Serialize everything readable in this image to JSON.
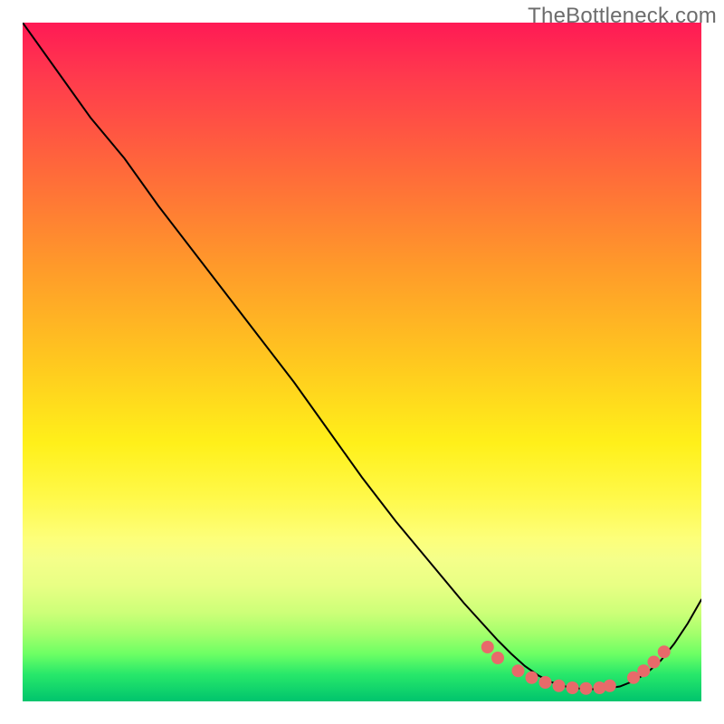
{
  "watermark": {
    "text": "TheBottleneck.com"
  },
  "chart_data": {
    "type": "line",
    "title": "",
    "xlabel": "",
    "ylabel": "",
    "x": [
      0,
      5,
      10,
      15,
      20,
      25,
      30,
      35,
      40,
      45,
      50,
      55,
      60,
      65,
      70,
      72,
      74,
      76,
      78,
      80,
      82,
      84,
      86,
      88,
      90,
      92,
      94,
      96,
      98,
      100
    ],
    "values": [
      100,
      93,
      86,
      80,
      73,
      66.5,
      60,
      53.5,
      47,
      40,
      33,
      26.5,
      20.5,
      14.5,
      9,
      7,
      5.2,
      3.8,
      2.8,
      2.2,
      1.9,
      1.8,
      1.9,
      2.2,
      3.0,
      4.2,
      6.0,
      8.5,
      11.5,
      15
    ],
    "xlim": [
      0,
      100
    ],
    "ylim": [
      0,
      100
    ],
    "grid": false,
    "legend": false,
    "background_gradient": {
      "type": "vertical",
      "stops": [
        {
          "pos": 0.0,
          "color": "#ff1a55"
        },
        {
          "pos": 0.5,
          "color": "#ffc81f"
        },
        {
          "pos": 0.8,
          "color": "#f5ff8a"
        },
        {
          "pos": 1.0,
          "color": "#00c46d"
        }
      ]
    },
    "marker_series": {
      "name": "optimal-band",
      "color": "#e86a6a",
      "points": [
        {
          "x": 68.5,
          "y": 8.0
        },
        {
          "x": 70.0,
          "y": 6.4
        },
        {
          "x": 73.0,
          "y": 4.5
        },
        {
          "x": 75.0,
          "y": 3.5
        },
        {
          "x": 77.0,
          "y": 2.8
        },
        {
          "x": 79.0,
          "y": 2.3
        },
        {
          "x": 81.0,
          "y": 2.0
        },
        {
          "x": 83.0,
          "y": 1.9
        },
        {
          "x": 85.0,
          "y": 2.0
        },
        {
          "x": 86.5,
          "y": 2.3
        },
        {
          "x": 90.0,
          "y": 3.5
        },
        {
          "x": 91.5,
          "y": 4.5
        },
        {
          "x": 93.0,
          "y": 5.8
        },
        {
          "x": 94.5,
          "y": 7.3
        }
      ]
    }
  }
}
